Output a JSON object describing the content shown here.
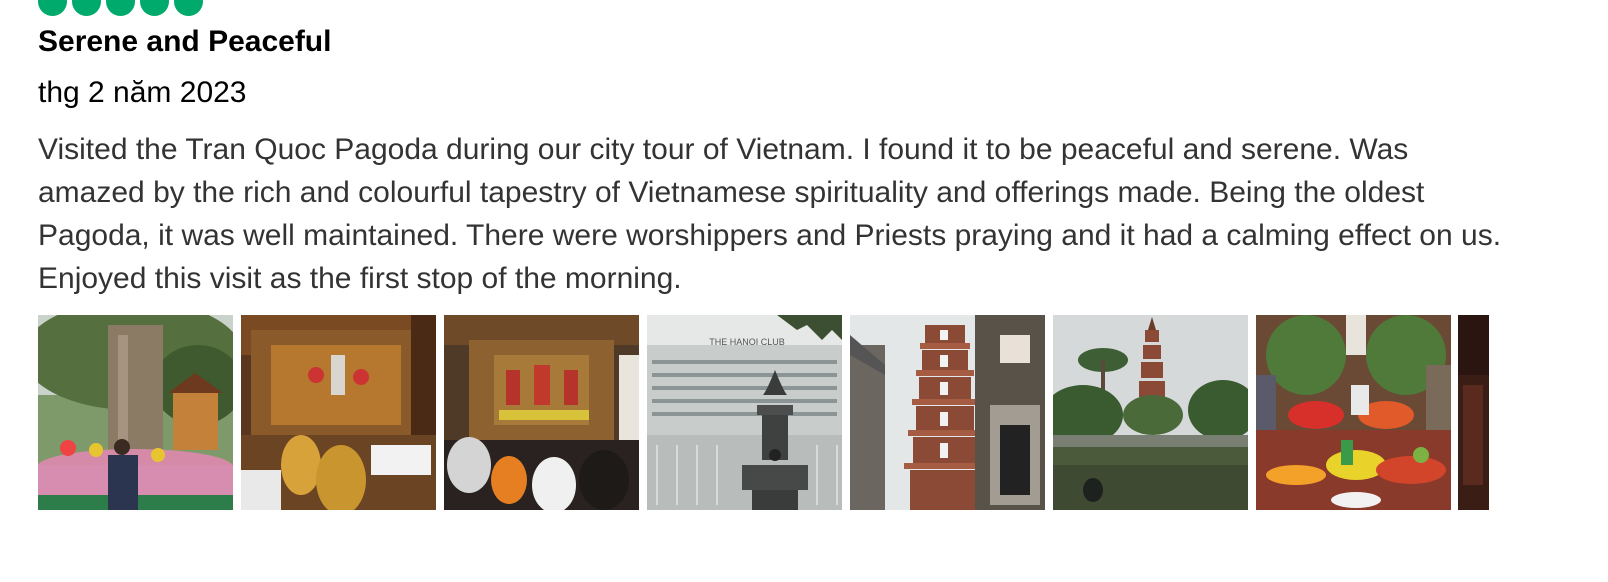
{
  "review": {
    "rating_bubbles": 5,
    "rating_color": "#00aa6c",
    "title": "Serene and Peaceful",
    "date": "thg 2 năm 2023",
    "text": "Visited the Tran Quoc Pagoda during our city tour of Vietnam. I found it to be peaceful and serene. Was amazed by the rich and colourful tapestry of Vietnamese spirituality and offerings made. Being the oldest Pagoda, it was well maintained. There were worshippers and Priests praying and it had a calming effect on us. Enjoyed this visit as the first stop of the morning.",
    "photo_sign_text": "THE HANOI CLUB"
  },
  "photos": [
    {
      "name": "banyan-tree-photo"
    },
    {
      "name": "altar-monks-photo"
    },
    {
      "name": "shrine-worshippers-photo"
    },
    {
      "name": "lake-lantern-photo"
    },
    {
      "name": "pagoda-tower-photo"
    },
    {
      "name": "lake-pagoda-photo"
    },
    {
      "name": "fruit-offerings-photo"
    },
    {
      "name": "partial-photo"
    }
  ]
}
